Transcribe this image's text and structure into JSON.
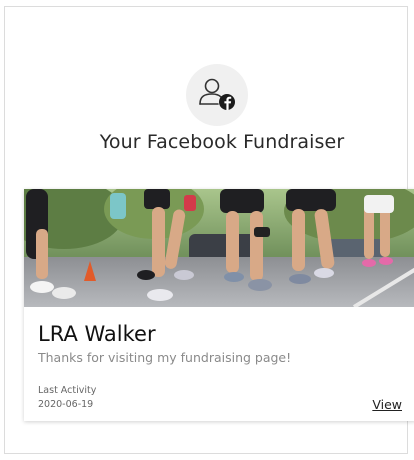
{
  "header": {
    "title": "Your Facebook Fundraiser",
    "icon": "user-facebook-icon"
  },
  "card": {
    "image": "runners-photo",
    "name": "LRA Walker",
    "description": "Thanks for visiting my fundraising page!",
    "last_activity_label": "Last Activity",
    "last_activity_date": "2020-06-19",
    "view_label": "View"
  },
  "colors": {
    "facebook_badge": "#1b1b1b",
    "icon_background": "#f0f0f0",
    "text": "#111111",
    "muted_text": "#8a8a8a"
  }
}
